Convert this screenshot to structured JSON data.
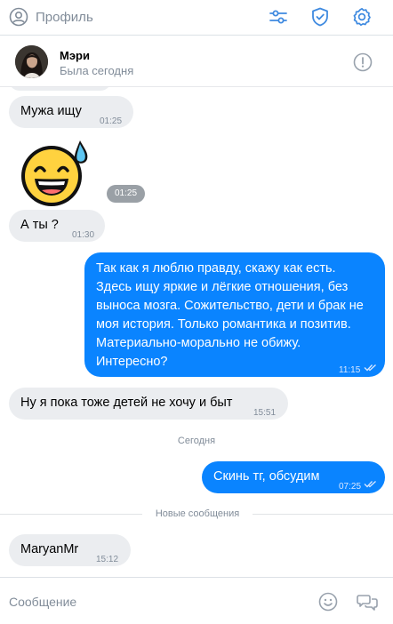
{
  "topbar": {
    "profile_label": "Профиль",
    "icons": [
      "filter-icon",
      "shield-check-icon",
      "gear-icon"
    ]
  },
  "contact": {
    "name": "Мэри",
    "status": "Была сегодня"
  },
  "messages": [
    {
      "text": "Мужа ищу",
      "time": "01:25",
      "direction": "in"
    },
    {
      "sticker": "grinning-sweat-emoji",
      "time": "01:25",
      "direction": "in"
    },
    {
      "text": "А ты ?",
      "time": "01:30",
      "direction": "in"
    },
    {
      "lines": [
        "Так как я люблю правду, скажу как есть.",
        "Здесь ищу яркие и лёгкие отношения, без",
        "выноса мозга. Сожительство, дети и брак не",
        "моя история. Только романтика и позитив.",
        "Материально-морально не обижу.",
        "Интересно?"
      ],
      "time": "11:15",
      "direction": "out",
      "read": true
    },
    {
      "text": "Ну я пока тоже детей не хочу и быт",
      "time": "15:51",
      "direction": "in"
    },
    {
      "text": "Скинь тг, обсудим",
      "time": "07:25",
      "direction": "out",
      "read": true
    },
    {
      "text": "MaryanMr",
      "time": "15:12",
      "direction": "in"
    }
  ],
  "separators": {
    "today": "Сегодня",
    "new_messages": "Новые сообщения"
  },
  "composer": {
    "placeholder": "Сообщение"
  },
  "colors": {
    "accent": "#0a84ff",
    "incoming_bubble": "#ebedf0",
    "muted_text": "#818c99",
    "icon": "#3f8ae0"
  }
}
